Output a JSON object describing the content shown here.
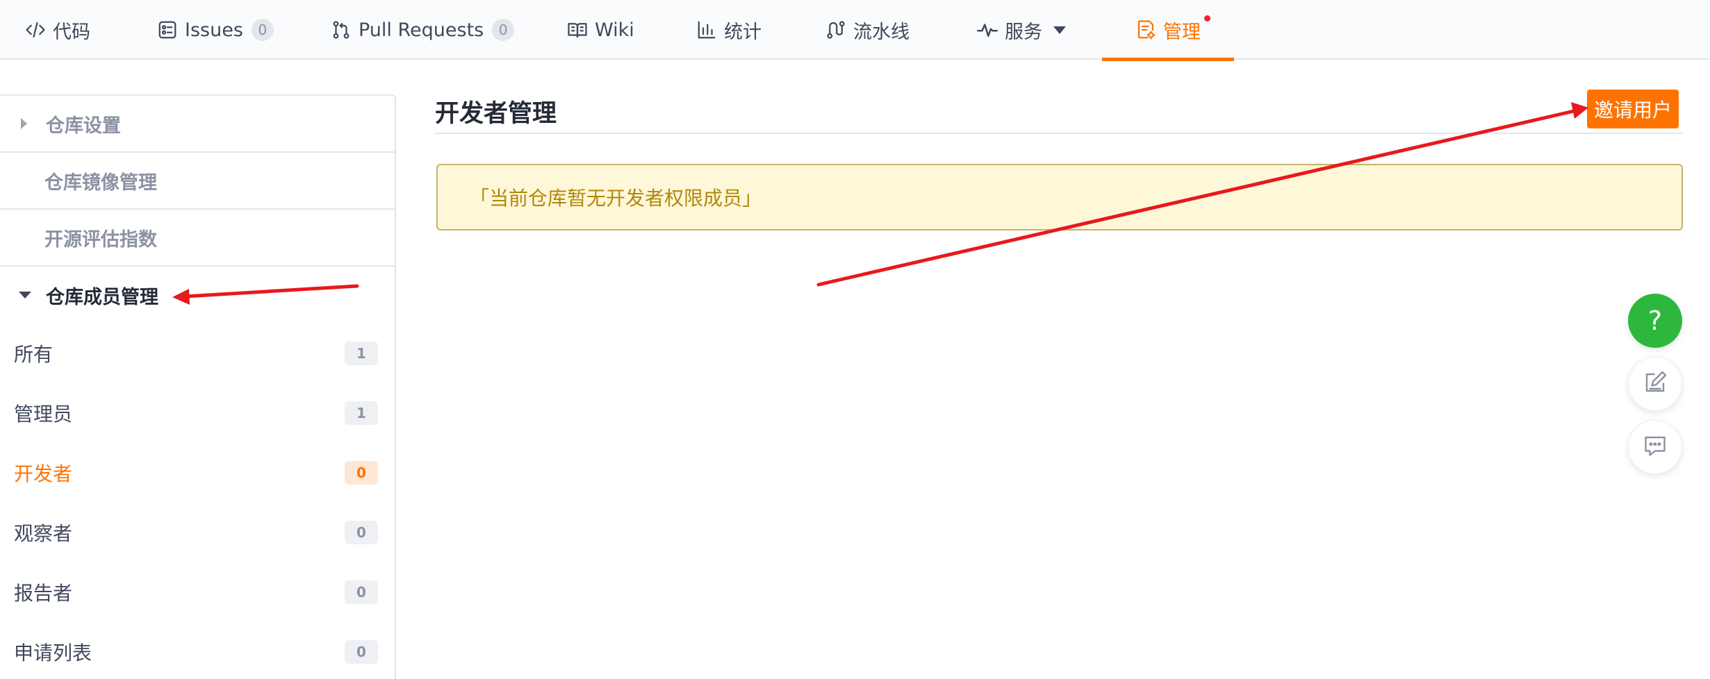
{
  "nav": {
    "tabs": [
      {
        "label": "代码",
        "icon": "code-icon"
      },
      {
        "label": "Issues",
        "icon": "issues-icon",
        "count": "0"
      },
      {
        "label": "Pull Requests",
        "icon": "pull-request-icon",
        "count": "0"
      },
      {
        "label": "Wiki",
        "icon": "wiki-book-icon"
      },
      {
        "label": "统计",
        "icon": "bar-chart-icon"
      },
      {
        "label": "流水线",
        "icon": "pipeline-icon"
      },
      {
        "label": "服务",
        "icon": "pulse-icon"
      },
      {
        "label": "管理",
        "icon": "manage-doc-icon",
        "active": true
      }
    ]
  },
  "sidebar": {
    "groups": [
      {
        "label": "仓库设置"
      },
      {
        "label": "仓库镜像管理"
      },
      {
        "label": "开源评估指数"
      },
      {
        "label": "仓库成员管理"
      }
    ],
    "members": [
      {
        "label": "所有",
        "count": "1"
      },
      {
        "label": "管理员",
        "count": "1"
      },
      {
        "label": "开发者",
        "count": "0",
        "active": true
      },
      {
        "label": "观察者",
        "count": "0"
      },
      {
        "label": "报告者",
        "count": "0"
      },
      {
        "label": "申请列表",
        "count": "0"
      }
    ]
  },
  "main": {
    "title": "开发者管理",
    "invite_label": "邀请用户",
    "notice": "「当前仓库暂无开发者权限成员」"
  },
  "fab": {
    "help_label": "?"
  },
  "colors": {
    "accent": "#fe7300",
    "help_green": "#2db83d",
    "notice_bg": "#fef7d8",
    "notice_text": "#b2870c",
    "annotation_red": "#e8191c"
  }
}
